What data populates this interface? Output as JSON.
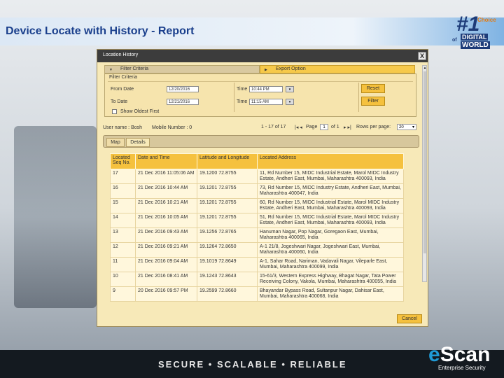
{
  "slide": {
    "title": "Device Locate with History - Report",
    "badge": {
      "number": "#1",
      "choice": "Choice",
      "of": "of",
      "digital": "DIGITAL",
      "world": "WORLD"
    },
    "tagline": "SECURE • SCALABLE • RELIABLE",
    "brand": {
      "e": "e",
      "rest": "Scan",
      "sub": "Enterprise Security"
    }
  },
  "window": {
    "title": "Location History",
    "close_label": "X",
    "filter_tab": "Filter Criteria",
    "export_tab": "Export Option",
    "filter": {
      "heading": "Filter Criteria",
      "from_date_label": "From Date",
      "from_date_value": "12/20/2016",
      "to_date_label": "To Date",
      "to_date_value": "12/21/2016",
      "time_label_1": "Time",
      "time_value_1": "10:44 PM",
      "time_label_2": "Time",
      "time_value_2": "11:15 AM",
      "reset_label": "Reset",
      "filter_label": "Filter",
      "show_oldest_label": "Show Oldest First"
    },
    "info": {
      "user_name": "User name : Bosh",
      "mobile_number": "Mobile Number : 0",
      "range": "1 - 17 of 17",
      "page_label": "Page",
      "page_value": "1",
      "of_pages": "of 1",
      "rows_per_page_label": "Rows per page:",
      "rows_per_page_value": "20"
    },
    "tabs": [
      {
        "label": "Map"
      },
      {
        "label": "Details"
      }
    ],
    "table": {
      "headers": [
        "Located Seq No.",
        "Date and Time",
        "Latitude and Longitude",
        "Located Address"
      ],
      "rows": [
        [
          "17",
          "21 Dec 2016 11:05:06 AM",
          "19.1200 72.8755",
          "11, Rd Number 15, MIDC Industrial Estate, Marol MIDC Industry Estate, Andheri East, Mumbai, Maharashtra 400093, India"
        ],
        [
          "16",
          "21 Dec 2016 10:44 AM",
          "19.1201 72.8755",
          "73, Rd Number 15, MIDC Industry Estate, Andheri East, Mumbai, Maharashtra 400047, India"
        ],
        [
          "15",
          "21 Dec 2016 10:21 AM",
          "19.1201 72.8755",
          "60, Rd Number 15, MIDC Industrial Estate, Marol MIDC Industry Estate, Andheri East, Mumbai, Maharashtra 400093, India"
        ],
        [
          "14",
          "21 Dec 2016 10:05 AM",
          "19.1201 72.8755",
          "51, Rd Number 15, MIDC Industrial Estate, Marol MIDC Industry Estate, Andheri East, Mumbai, Maharashtra 400093, India"
        ],
        [
          "13",
          "21 Dec 2016 09:43 AM",
          "19.1256 72.8765",
          "Hanuman Nagar, Pop Nagar, Goregaon East, Mumbai, Maharashtra 400065, India"
        ],
        [
          "12",
          "21 Dec 2016 09:21 AM",
          "19.1264 72.8650",
          "A-1 21/8, Jogeshwari Nagar, Jogeshwari East, Mumbai, Maharashtra 400060, India"
        ],
        [
          "11",
          "21 Dec 2016 09:04 AM",
          "19.1019 72.8649",
          "A-1, Sahar Road, Nariman, Vadavali Nagar, Vileparle East, Mumbai, Maharashtra 400099, India"
        ],
        [
          "10",
          "21 Dec 2016 08:41 AM",
          "19.1243 72.8643",
          "15-61/3, Western Express Highway, Bhagat Nagar, Tata Power Receiving Colony, Vakola, Mumbai, Maharashtra 400055, India"
        ],
        [
          "9",
          "20 Dec 2016 09:57 PM",
          "19.2599 72.8660",
          "Bhayandar Bypass Road, Sultanpur Nagar, Dahisar East, Mumbai, Maharashtra 400068, India"
        ]
      ]
    },
    "cancel_label": "Cancel"
  }
}
